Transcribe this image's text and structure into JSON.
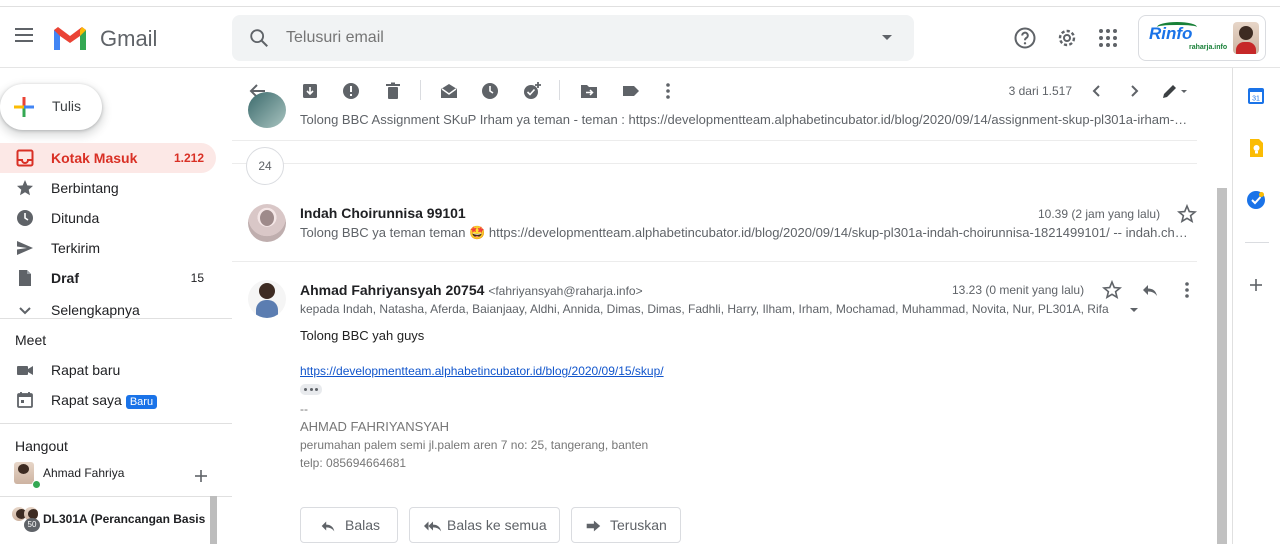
{
  "app": {
    "name": "Gmail"
  },
  "search": {
    "placeholder": "Telusuri email"
  },
  "account": {
    "brand": "Rinfo",
    "brand_sub": "raharja.info"
  },
  "sidebar": {
    "compose_label": "Tulis",
    "items": [
      {
        "label": "Kotak Masuk",
        "count": "1.212",
        "icon": "inbox-icon",
        "active": true
      },
      {
        "label": "Berbintang",
        "count": "",
        "icon": "star-icon"
      },
      {
        "label": "Ditunda",
        "count": "",
        "icon": "clock-icon"
      },
      {
        "label": "Terkirim",
        "count": "",
        "icon": "send-icon"
      },
      {
        "label": "Draf",
        "count": "15",
        "icon": "draft-icon"
      },
      {
        "label": "Selengkapnya",
        "count": "",
        "icon": "chevron-down-icon"
      }
    ],
    "meet": {
      "title": "Meet",
      "new_meeting": "Rapat baru",
      "my_meetings": "Rapat saya",
      "badge": "Baru"
    },
    "hangout": {
      "title": "Hangout",
      "user": "Ahmad Fahriya",
      "group": "DL301A (Perancangan Basis",
      "group_count": "50"
    }
  },
  "toolbar": {
    "pager": "3 dari 1.517"
  },
  "thread": {
    "top_snippet": "Tolong BBC Assignment SKuP Irham ya teman - teman : https://developmentteam.alphabetincubator.id/blog/2020/09/14/assignment-skup-pl301a-irham-aldiy…",
    "collapsed_count": "24",
    "messages": [
      {
        "sender": "Indah Choirunnisa 99101",
        "time": "10.39 (2 jam yang lalu)",
        "snippet": "Tolong BBC ya teman teman 🤩 https://developmentteam.alphabetincubator.id/blog/2020/09/14/skup-pl301a-indah-choirunnisa-1821499101/ -- indah.choiru…"
      },
      {
        "sender": "Ahmad Fahriyansyah 20754",
        "email": "<fahriyansyah@raharja.info>",
        "time": "13.23 (0 menit yang lalu)",
        "to": "kepada Indah, Natasha, Aferda, Baianjaay, Aldhi, Annida, Dimas, Dimas, Fadhli, Harry, Ilham, Irham, Mochamad, Muhammad, Novita, Nur, PL301A, Rifa",
        "body": "Tolong BBC yah guys",
        "link": "https://developmentteam.alphabetincubator.id/blog/2020/09/15/skup/",
        "sig_dash": "--",
        "sig_name": "AHMAD FAHRIYANSYAH",
        "sig_addr": "perumahan palem semi jl.palem aren 7 no: 25, tangerang, banten",
        "sig_phone": "telp: 085694664681"
      }
    ],
    "actions": {
      "reply": "Balas",
      "reply_all": "Balas ke semua",
      "forward": "Teruskan"
    }
  },
  "colors": {
    "accent_red": "#d93025",
    "link_blue": "#1155cc",
    "badge_blue": "#1a73e8"
  }
}
